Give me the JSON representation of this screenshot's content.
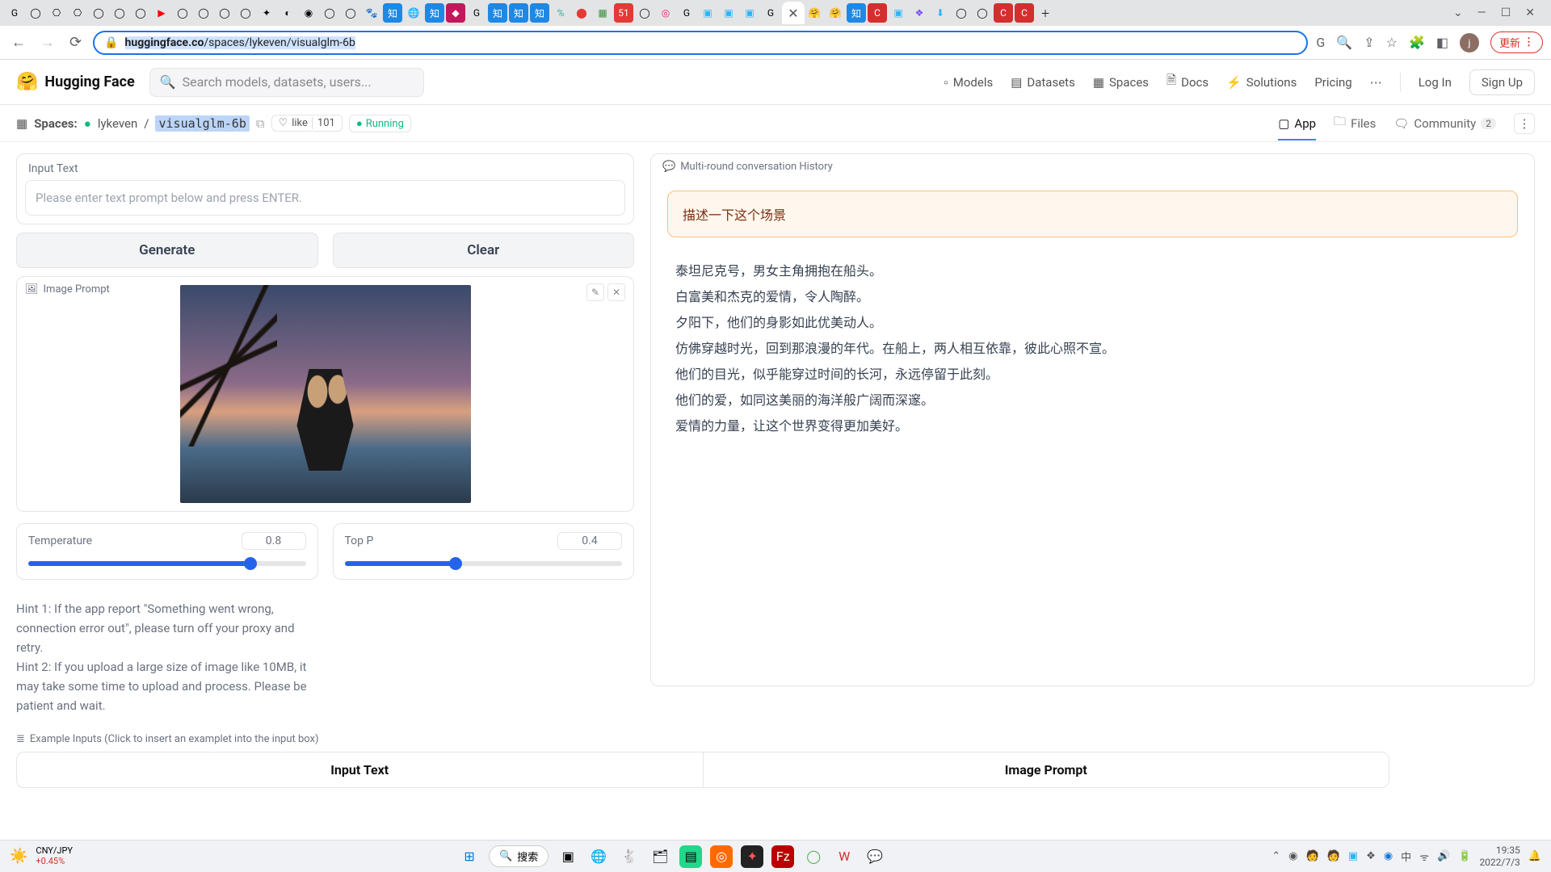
{
  "browser": {
    "url_host": "huggingface.co",
    "url_rest": "/spaces/lykeven/visualglm-6b",
    "update_label": "更新"
  },
  "hf": {
    "brand": "Hugging Face",
    "search_placeholder": "Search models, datasets, users...",
    "nav": {
      "models": "Models",
      "datasets": "Datasets",
      "spaces": "Spaces",
      "docs": "Docs",
      "solutions": "Solutions",
      "pricing": "Pricing",
      "login": "Log In",
      "signup": "Sign Up"
    }
  },
  "space": {
    "section": "Spaces:",
    "owner": "lykeven",
    "name": "visualglm-6b",
    "like_label": "like",
    "likes": "101",
    "status": "Running",
    "tabs": {
      "app": "App",
      "files": "Files",
      "community": "Community",
      "community_count": "2"
    }
  },
  "ui": {
    "input_label": "Input Text",
    "input_placeholder": "Please enter text prompt below and press ENTER.",
    "generate": "Generate",
    "clear": "Clear",
    "image_prompt": "Image Prompt",
    "temperature_label": "Temperature",
    "temperature_value": "0.8",
    "temperature_pct": 80,
    "topp_label": "Top P",
    "topp_value": "0.4",
    "topp_pct": 40,
    "hint1": "Hint 1: If the app report \"Something went wrong, connection error out\", please turn off your proxy and retry.",
    "hint2": "Hint 2: If you upload a large size of image like 10MB, it may take some time to upload and process. Please be patient and wait.",
    "examples_label": "Example Inputs (Click to insert an examplet into the input box)",
    "example_cols": {
      "a": "Input Text",
      "b": "Image Prompt"
    }
  },
  "chat": {
    "history_label": "Multi-round conversation History",
    "user": "描述一下这个场景",
    "ai_lines": [
      "泰坦尼克号，男女主角拥抱在船头。",
      "白富美和杰克的爱情，令人陶醉。",
      "夕阳下，他们的身影如此优美动人。",
      "仿佛穿越时光，回到那浪漫的年代。在船上，两人相互依靠，彼此心照不宣。",
      "他们的目光，似乎能穿过时间的长河，永远停留于此刻。",
      "他们的爱，如同这美丽的海洋般广阔而深邃。",
      "爱情的力量，让这个世界变得更加美好。"
    ]
  },
  "taskbar": {
    "fx_label": "CNY/JPY",
    "fx_change": "+0.45%",
    "search": "搜索",
    "time": "19:35",
    "date": "2022/7/3"
  }
}
